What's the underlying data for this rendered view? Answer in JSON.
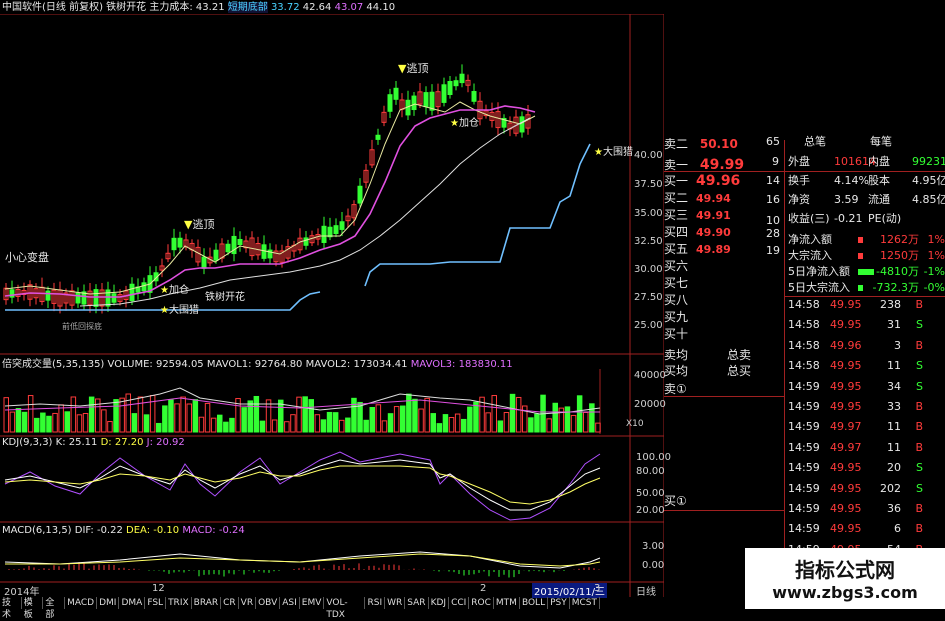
{
  "header": {
    "title": "中国软件(日线 前复权) 铁树开花",
    "cost_label": "主力成本:",
    "cost_value": "43.21",
    "chip_label": "短期底部",
    "chip_value": "33.72",
    "v2": "42.64",
    "v3": "43.07",
    "v4": "44.10"
  },
  "annotations": {
    "escape_top_1": "逃顶",
    "escape_top_2": "逃顶",
    "add_position_1": "加仓",
    "add_position_2": "加仓",
    "big_hunt_1": "大围猎",
    "big_hunt_2": "大围猎",
    "iron_tree": "铁树开花",
    "careful": "小心变盘",
    "low_label": "前低回探底"
  },
  "price_axis": [
    "40.00",
    "37.50",
    "35.00",
    "32.50",
    "30.00",
    "27.50",
    "25.00"
  ],
  "volume": {
    "title": "倍突成交量(5,35,135)",
    "volume_label": "VOLUME: 92594.05",
    "mavol1": "MAVOL1: 92764.80",
    "mavol2": "MAVOL2: 173034.41",
    "mavol3": "MAVOL3: 183830.11",
    "axis": [
      "40000",
      "20000"
    ],
    "unit": "X10"
  },
  "kdj": {
    "title": "KDJ(9,3,3)",
    "k": "K: 25.11",
    "d": "D: 27.20",
    "j": "J: 20.92",
    "axis": [
      "100.00",
      "80.00",
      "50.00",
      "20.00"
    ]
  },
  "macd": {
    "title": "MACD(6,13,5)",
    "dif": "DIF: -0.22",
    "dea": "DEA: -0.10",
    "macd": "MACD: -0.24",
    "axis": [
      "3.00",
      "0.00"
    ]
  },
  "time_axis": {
    "start": "2014年",
    "month": "12",
    "m2": "2",
    "date_box": "2015/02/11/三",
    "right_num": "3"
  },
  "order_book": {
    "sells": [
      {
        "label": "卖二",
        "price": "50.10"
      },
      {
        "label": "卖一",
        "price": "49.99"
      }
    ],
    "buys": [
      {
        "label": "买一",
        "price": "49.96"
      },
      {
        "label": "买二",
        "price": "49.94"
      },
      {
        "label": "买三",
        "price": "49.91"
      },
      {
        "label": "买四",
        "price": "49.90"
      },
      {
        "label": "买五",
        "price": "49.89"
      },
      {
        "label": "买六",
        "price": ""
      },
      {
        "label": "买七",
        "price": ""
      },
      {
        "label": "买八",
        "price": ""
      },
      {
        "label": "买九",
        "price": ""
      },
      {
        "label": "买十",
        "price": ""
      }
    ],
    "sell_avg": "卖均",
    "buy_avg": "买均",
    "total_sell": "总卖",
    "total_buy": "总买",
    "sell_1": "卖①",
    "buy_1": "买①",
    "left_nums": [
      "65",
      "14",
      "16",
      "10",
      "28",
      "19"
    ],
    "qty_col": [
      "9"
    ]
  },
  "summary": {
    "top_a": "总笔",
    "top_b": "每笔",
    "rows": [
      {
        "l": "外盘",
        "lv": "101614",
        "r": "内盘",
        "rv": "99231"
      },
      {
        "l": "换手",
        "lv": "4.14%",
        "r": "股本",
        "rv": "4.95亿"
      },
      {
        "l": "净资",
        "lv": "3.59",
        "r": "流通",
        "rv": "4.85亿"
      },
      {
        "l": "收益(三)",
        "lv": "-0.21",
        "r": "PE(动)",
        "rv": ""
      }
    ],
    "flows": [
      {
        "label": "净流入额",
        "value": "1262万",
        "pct": "1%"
      },
      {
        "label": "大宗流入",
        "value": "1250万",
        "pct": "1%"
      },
      {
        "label": "5日净流入额",
        "value": "-4810万",
        "pct": "-1%"
      },
      {
        "label": "5日大宗流入",
        "value": "-732.3万",
        "pct": "-0%"
      }
    ]
  },
  "ticks": [
    {
      "t": "14:58",
      "p": "49.95",
      "v": "238",
      "s": "B"
    },
    {
      "t": "14:58",
      "p": "49.95",
      "v": "31",
      "s": "S"
    },
    {
      "t": "14:58",
      "p": "49.96",
      "v": "3",
      "s": "B"
    },
    {
      "t": "14:58",
      "p": "49.95",
      "v": "11",
      "s": "S"
    },
    {
      "t": "14:59",
      "p": "49.95",
      "v": "34",
      "s": "S"
    },
    {
      "t": "14:59",
      "p": "49.95",
      "v": "33",
      "s": "B"
    },
    {
      "t": "14:59",
      "p": "49.97",
      "v": "11",
      "s": "B"
    },
    {
      "t": "14:59",
      "p": "49.97",
      "v": "11",
      "s": "B"
    },
    {
      "t": "14:59",
      "p": "49.95",
      "v": "20",
      "s": "S"
    },
    {
      "t": "14:59",
      "p": "49.95",
      "v": "202",
      "s": "S"
    },
    {
      "t": "14:59",
      "p": "49.95",
      "v": "36",
      "s": "B"
    },
    {
      "t": "14:59",
      "p": "49.95",
      "v": "6",
      "s": "B"
    },
    {
      "t": "14:59",
      "p": "49.95",
      "v": "54",
      "s": "B"
    },
    {
      "t": "14:59",
      "p": "49.97",
      "v": "12",
      "s": "B"
    },
    {
      "t": "14:59",
      "p": "49.95",
      "v": "81",
      "s": "S"
    }
  ],
  "bottom": {
    "daily": "日线",
    "tabs": [
      "技术",
      "模板",
      "全部",
      "MACD",
      "DMI",
      "DMA",
      "FSL",
      "TRIX",
      "BRAR",
      "CR",
      "VR",
      "OBV",
      "ASI",
      "EMV",
      "VOL-TDX",
      "RSI",
      "WR",
      "SAR",
      "KDJ",
      "CCI",
      "ROC",
      "MTM",
      "BOLL",
      "PSY",
      "MCST"
    ]
  },
  "watermark": {
    "title": "指标公式网",
    "url": "www.zbgs3.com"
  },
  "colors": {
    "up": "#ff3b3b",
    "down": "#33ff33",
    "bg": "#000000",
    "grid": "#a02020"
  }
}
